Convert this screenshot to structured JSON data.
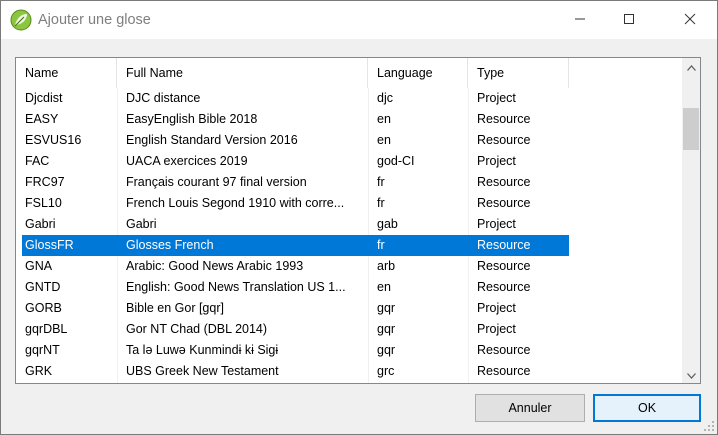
{
  "window": {
    "title": "Ajouter une glose",
    "app_icon": "leaf-icon",
    "controls": [
      "minimize-icon",
      "maximize-icon",
      "close-icon"
    ]
  },
  "table": {
    "columns": [
      "Name",
      "Full Name",
      "Language",
      "Type"
    ],
    "rows": [
      {
        "name": "Djcdist",
        "full_name": "DJC distance",
        "language": "djc",
        "type": "Project"
      },
      {
        "name": "EASY",
        "full_name": "EasyEnglish Bible 2018",
        "language": "en",
        "type": "Resource"
      },
      {
        "name": "ESVUS16",
        "full_name": "English Standard Version 2016",
        "language": "en",
        "type": "Resource"
      },
      {
        "name": "FAC",
        "full_name": "UACA exercices 2019",
        "language": "god-CI",
        "type": "Project"
      },
      {
        "name": "FRC97",
        "full_name": "Français courant 97 final version",
        "language": "fr",
        "type": "Resource"
      },
      {
        "name": "FSL10",
        "full_name": "French Louis Segond 1910 with corre...",
        "language": "fr",
        "type": "Resource"
      },
      {
        "name": "Gabri",
        "full_name": "Gabri",
        "language": "gab",
        "type": "Project"
      },
      {
        "name": "GlossFR",
        "full_name": "Glosses French",
        "language": "fr",
        "type": "Resource"
      },
      {
        "name": "GNA",
        "full_name": "Arabic: Good News Arabic 1993",
        "language": "arb",
        "type": "Resource"
      },
      {
        "name": "GNTD",
        "full_name": "English: Good News Translation US 1...",
        "language": "en",
        "type": "Resource"
      },
      {
        "name": "GORB",
        "full_name": "Bible en Gor [gqr]",
        "language": "gqr",
        "type": "Project"
      },
      {
        "name": "gqrDBL",
        "full_name": "Gor NT Chad (DBL 2014)",
        "language": "gqr",
        "type": "Project"
      },
      {
        "name": "gqrNT",
        "full_name": "Ta lə Luwə Kunmindɨ kɨ Sigɨ",
        "language": "gqr",
        "type": "Resource"
      },
      {
        "name": "GRK",
        "full_name": "UBS Greek New Testament",
        "language": "grc",
        "type": "Resource"
      }
    ],
    "selected_index": 7
  },
  "buttons": {
    "cancel": "Annuler",
    "ok": "OK"
  },
  "colors": {
    "selection": "#0078d7",
    "title_text": "#7f7f7f"
  }
}
